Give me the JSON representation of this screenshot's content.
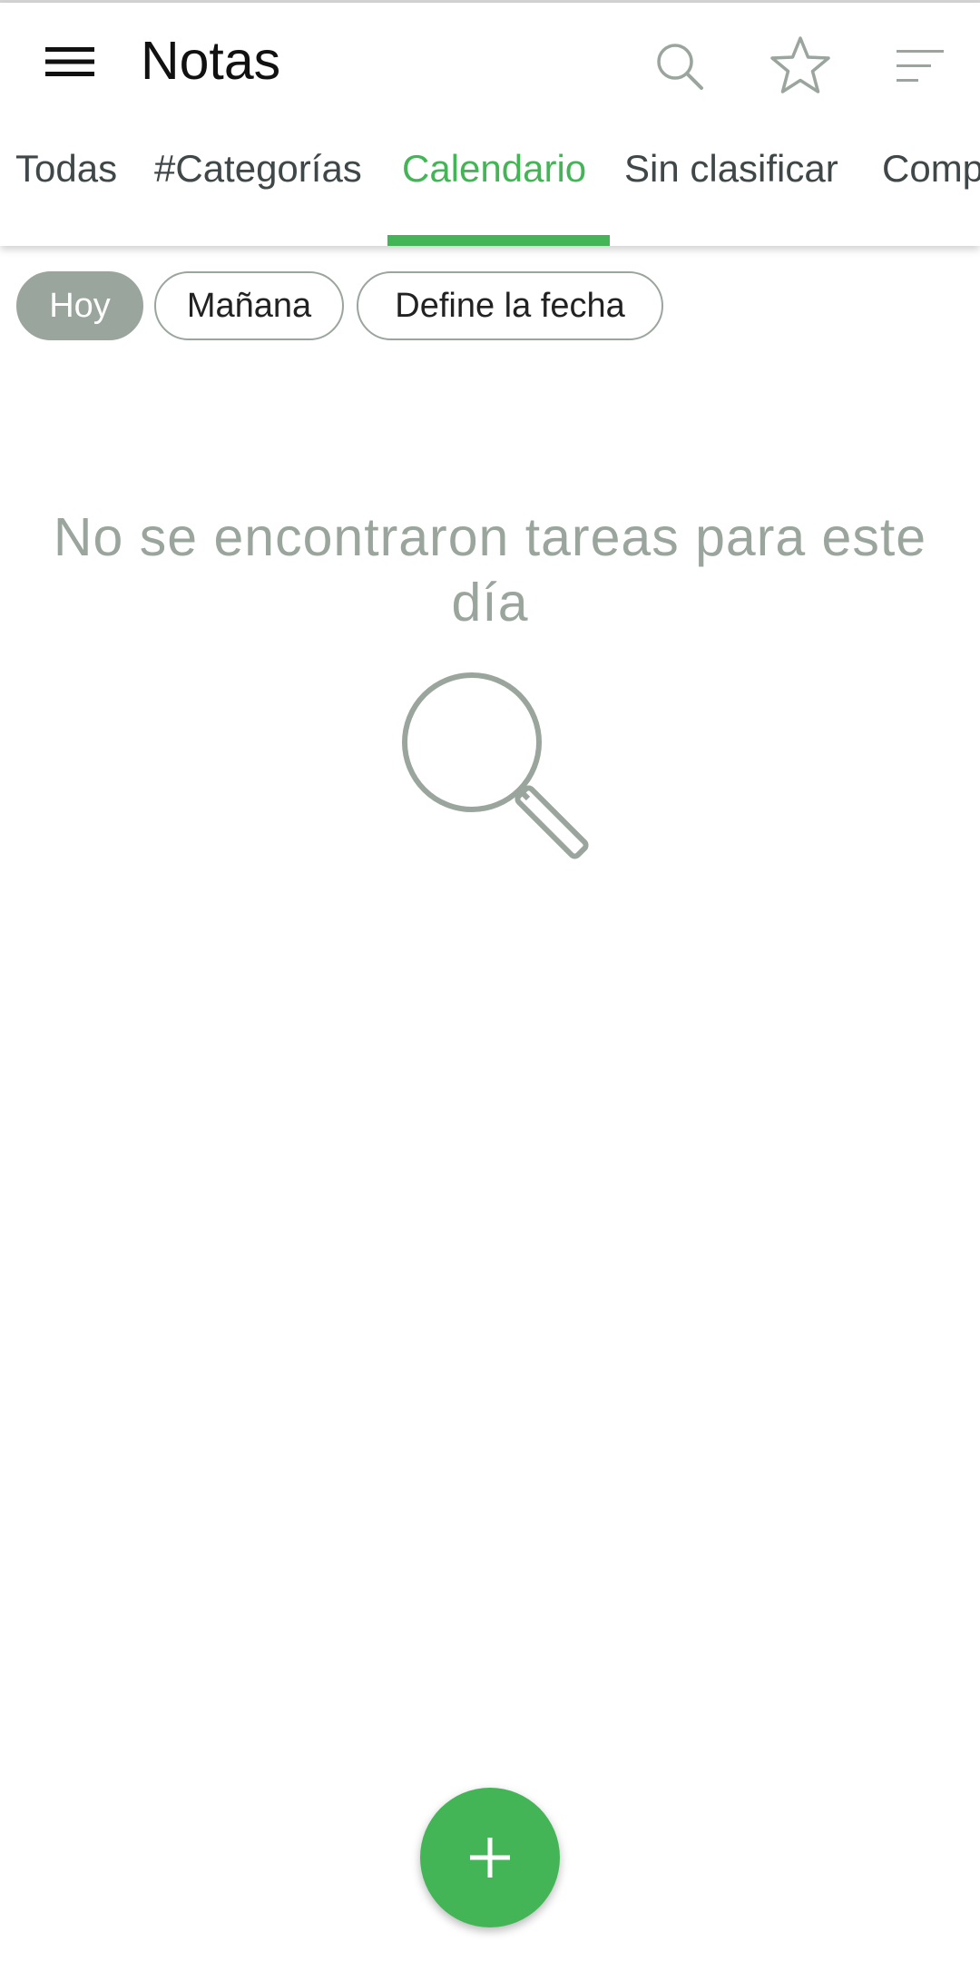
{
  "app": {
    "title": "Notas"
  },
  "toolbar": {
    "menu_icon": "hamburger-menu-icon",
    "actions": [
      {
        "icon": "search-icon"
      },
      {
        "icon": "star-outline-icon"
      },
      {
        "icon": "sort-icon"
      }
    ]
  },
  "tabs": [
    {
      "label": "Todas",
      "active": false
    },
    {
      "label": "#Categorías",
      "active": false
    },
    {
      "label": "Calendario",
      "active": true
    },
    {
      "label": "Sin clasificar",
      "active": false
    },
    {
      "label": "Comp",
      "active": false
    }
  ],
  "date_filter": {
    "chips": [
      {
        "label": "Hoy",
        "selected": true
      },
      {
        "label": "Mañana",
        "selected": false
      },
      {
        "label": "Define la fecha",
        "selected": false
      }
    ]
  },
  "empty_state": {
    "message": "No se encontraron tareas para este día",
    "icon": "magnifier-icon"
  },
  "fab": {
    "icon": "plus-icon"
  },
  "colors": {
    "accent": "#44b556",
    "muted": "#9aa59d",
    "text": "#3f4748"
  }
}
